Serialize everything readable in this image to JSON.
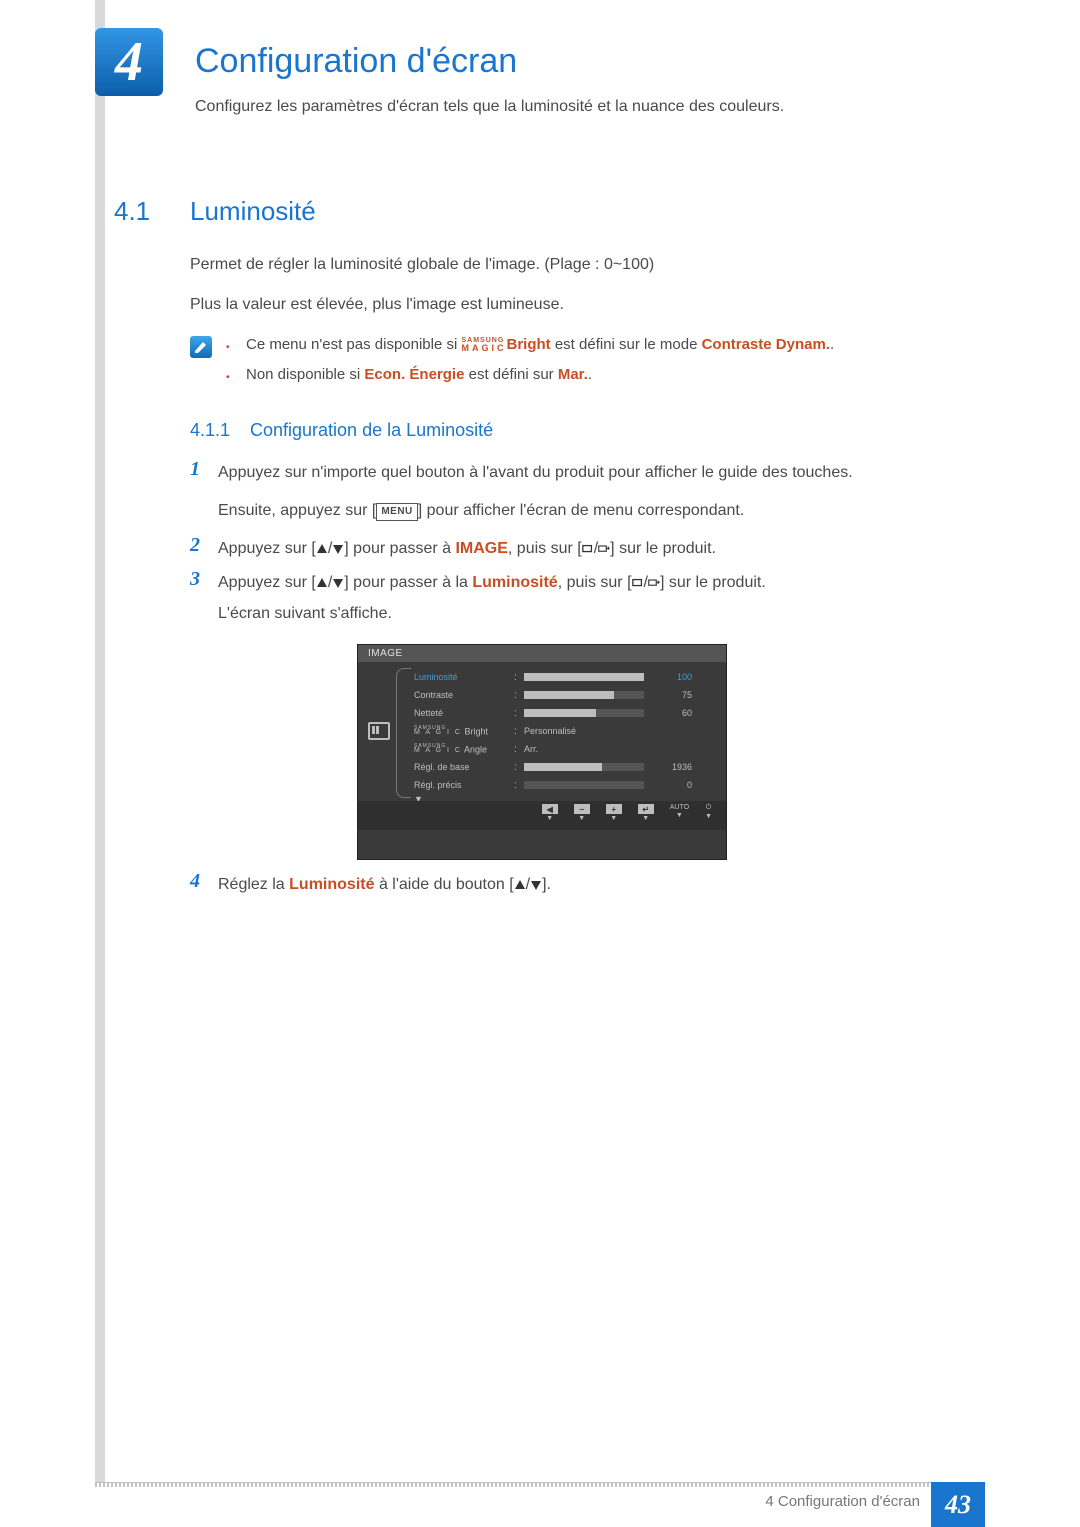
{
  "chapter": {
    "number": "4",
    "title": "Configuration d'écran",
    "intro": "Configurez les paramètres d'écran tels que la luminosité et la nuance des couleurs."
  },
  "section": {
    "number": "4.1",
    "title": "Luminosité",
    "para1": "Permet de régler la luminosité globale de l'image. (Plage : 0~100)",
    "para2": "Plus la valeur est élevée, plus l'image est lumineuse."
  },
  "notes": {
    "n1": {
      "pre": "Ce menu n'est pas disponible si ",
      "brand_top": "SAMSUNG",
      "brand_bottom": "MAGIC",
      "bright": "Bright",
      "mid": " est défini sur le mode ",
      "hl": "Contraste Dynam.",
      "end": "."
    },
    "n2": {
      "pre": "Non disponible si ",
      "hl1": "Econ. Énergie",
      "mid": " est défini sur ",
      "hl2": "Mar.",
      "end": "."
    }
  },
  "subsection": {
    "number": "4.1.1",
    "title": "Configuration de la Luminosité"
  },
  "steps": {
    "s1": {
      "num": "1",
      "l1": "Appuyez sur n'importe quel bouton à l'avant du produit pour afficher le guide des touches.",
      "l2a": "Ensuite, appuyez sur [",
      "menu": "MENU",
      "l2b": "] pour afficher l'écran de menu correspondant."
    },
    "s2": {
      "num": "2",
      "a": "Appuyez sur [",
      "b": "] pour passer à ",
      "hl": "IMAGE",
      "c": ", puis sur [",
      "d": "] sur le produit."
    },
    "s3": {
      "num": "3",
      "a": "Appuyez sur [",
      "b": "] pour passer à la ",
      "hl": "Luminosité",
      "c": ", puis sur [",
      "d": "] sur le produit.",
      "l2": "L'écran suivant s'affiche."
    },
    "s4": {
      "num": "4",
      "a": "Réglez la ",
      "hl": "Luminosité",
      "b": " à l'aide du bouton [",
      "c": "]."
    }
  },
  "osd": {
    "header": "IMAGE",
    "rows": {
      "r0": {
        "label": "Luminosité",
        "value": "100",
        "fill": 100
      },
      "r1": {
        "label": "Contraste",
        "value": "75",
        "fill": 75
      },
      "r2": {
        "label": "Netteté",
        "value": "60",
        "fill": 60
      },
      "r3": {
        "label_brand_top": "SAMSUNG",
        "label_brand_bot": "M A G I C",
        "label_suffix": " Bright",
        "value": "Personnalisé"
      },
      "r4": {
        "label_brand_top": "SAMSUNG",
        "label_brand_bot": "M A G I C",
        "label_suffix": " Angle",
        "value": "Arr."
      },
      "r5": {
        "label": "Régl. de base",
        "value": "1936",
        "fill": 65
      },
      "r6": {
        "label": "Régl. précis",
        "value": "0",
        "fill": 0
      }
    },
    "footer": {
      "auto": "AUTO"
    }
  },
  "footer": {
    "text": "4 Configuration d'écran",
    "page": "43"
  }
}
